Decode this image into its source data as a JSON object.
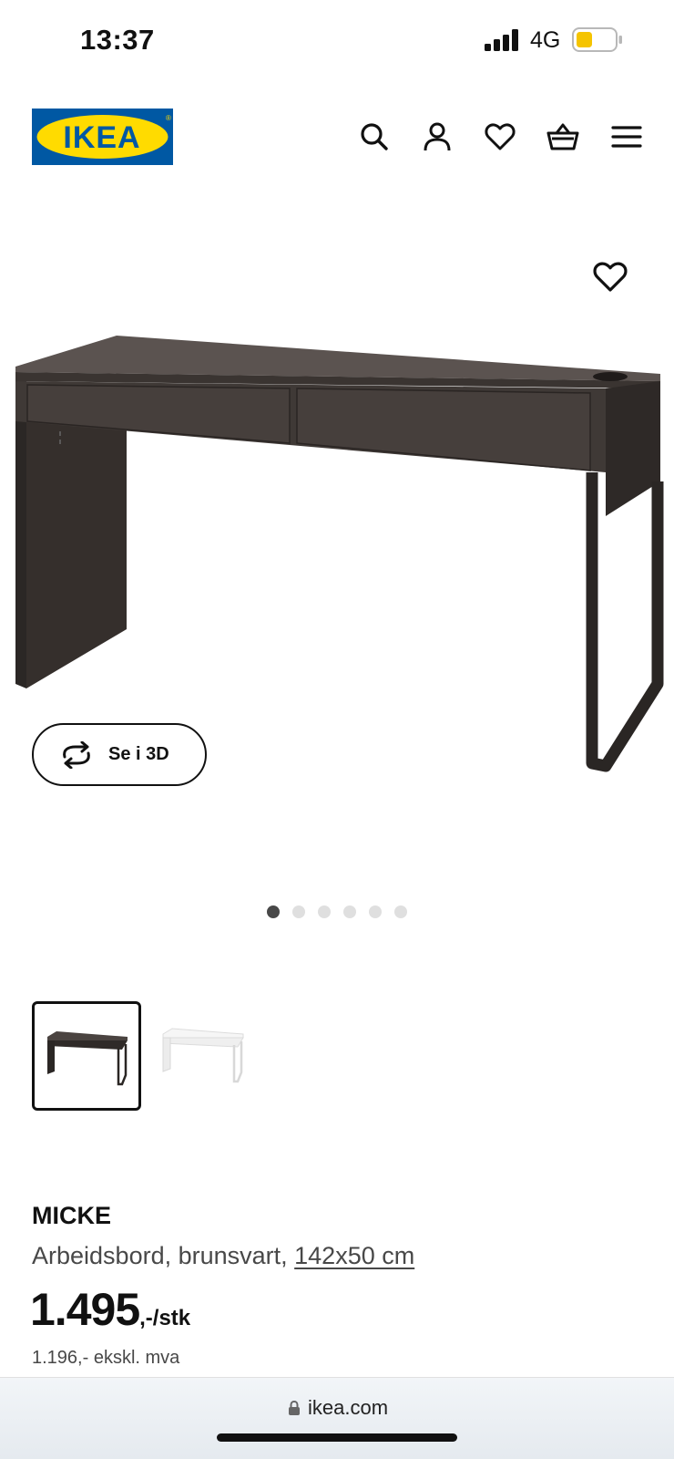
{
  "status_bar": {
    "time": "13:37",
    "network": "4G",
    "battery_color": "#f5c400"
  },
  "header": {
    "logo_text": "IKEA",
    "brand_colors": {
      "blue": "#0058a3",
      "yellow": "#ffdb00"
    },
    "icons": [
      "search-icon",
      "account-icon",
      "wishlist-icon",
      "basket-icon",
      "menu-icon"
    ]
  },
  "gallery": {
    "view_3d_label": "Se i 3D",
    "image_count": 6,
    "active_index": 0
  },
  "variants": [
    {
      "color_name": "brunsvart",
      "selected": true
    },
    {
      "color_name": "hvit",
      "selected": false
    }
  ],
  "product": {
    "name": "MICKE",
    "description": "Arbeidsbord, brunsvart, ",
    "dimensions": "142x50 cm",
    "price": "1.495",
    "price_suffix": ",-/stk",
    "price_ex_vat": "1.196,- ekskl. mva"
  },
  "browser": {
    "url": "ikea.com"
  }
}
